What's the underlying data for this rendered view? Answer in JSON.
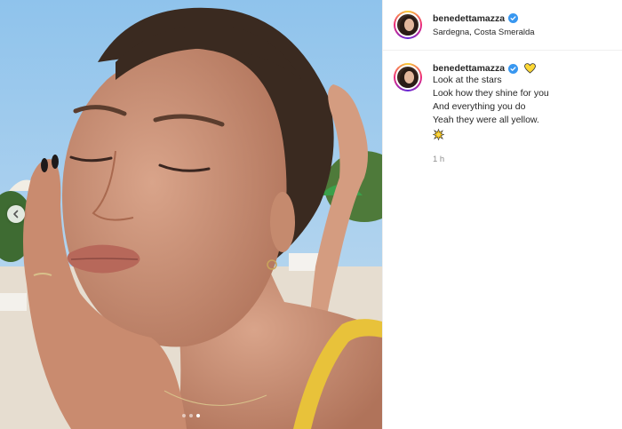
{
  "post": {
    "username": "benedettamazza",
    "location": "Sardegna, Costa Smeralda",
    "caption": {
      "username": "benedettamazza",
      "heart_emoji": "yellow-heart-icon",
      "lines": [
        "Look at the stars",
        "Look how they shine for you",
        "And everything you do",
        "Yeah they were all yellow."
      ],
      "trailing_emoji": "sparkle-icon",
      "timestamp": "1 h"
    },
    "media": {
      "slide_count": 3,
      "active_slide": 3,
      "description_icon": "photo"
    },
    "colors": {
      "verified": "#3897f0",
      "heart": "#fdd835"
    }
  }
}
